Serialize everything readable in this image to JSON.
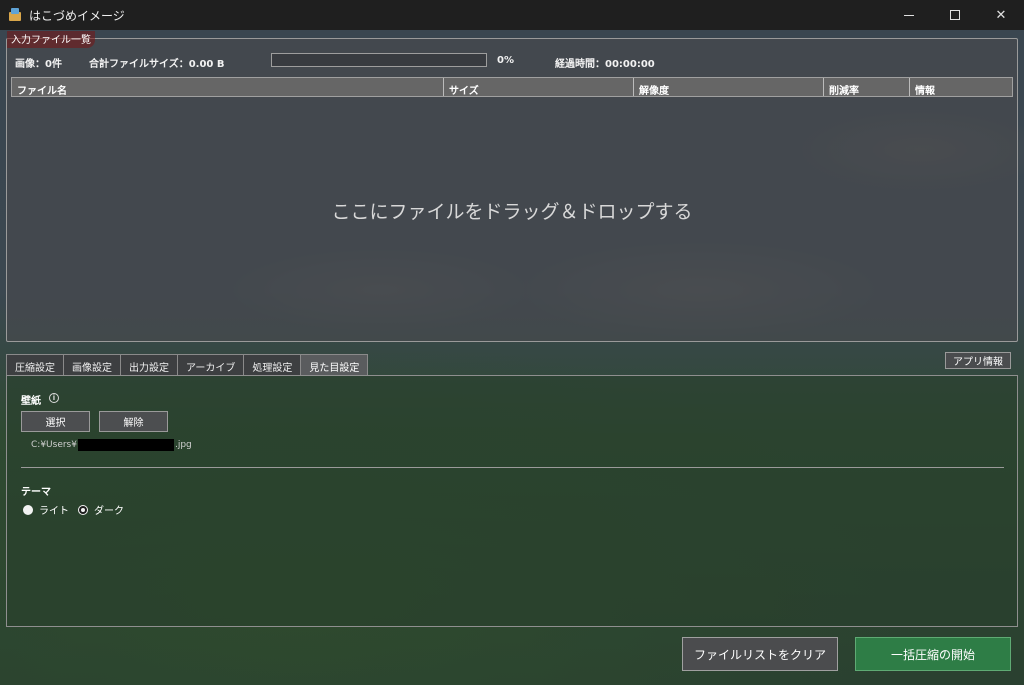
{
  "window": {
    "title": "はこづめイメージ"
  },
  "file_group": {
    "legend": "入力ファイル一覧",
    "images_stat": "画像：0件",
    "total_size_stat": "合計ファイルサイズ：0.00 B",
    "progress_fraction": 0.0,
    "progress_label": "0%",
    "elapsed_stat": "経過時間：00:00:00",
    "columns": [
      "ファイル名",
      "サイズ",
      "解像度",
      "削減率",
      "情報"
    ],
    "drop_hint": "ここにファイルをドラッグ＆ドロップする"
  },
  "tabs": [
    "圧縮設定",
    "画像設定",
    "出力設定",
    "アーカイブ",
    "処理設定",
    "見た目設定"
  ],
  "active_tab": "見た目設定",
  "app_info_label": "アプリ情報",
  "appearance": {
    "wallpaper_label": "壁紙",
    "info_icon": "info-icon",
    "select_label": "選択",
    "remove_label": "解除",
    "path_prefix": "C:¥Users¥",
    "path_suffix": ".jpg",
    "theme_label": "テーマ",
    "theme_light": "ライト",
    "theme_dark": "ダーク",
    "theme_selected": "ダーク"
  },
  "bottom": {
    "clear_label": "ファイルリストをクリア",
    "start_label": "一括圧縮の開始"
  },
  "colors": {
    "accent_green": "#2e7d46",
    "title_bar": "#1f1f1f"
  }
}
